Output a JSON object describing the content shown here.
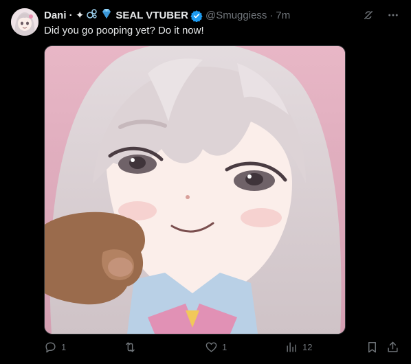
{
  "author": {
    "display_name": "Dani · ✦",
    "name_suffix": "SEAL VTUBER",
    "handle": "@Smuggiess",
    "separator": "·",
    "time": "7m",
    "avatar_icon": "anime-girl-avatar",
    "verified_color": "#1d9bf0"
  },
  "tweet": {
    "text": "Did you go pooping yet? Do it now!"
  },
  "media": {
    "kind": "image",
    "icon": "anime-girl-pointing-image"
  },
  "actions": {
    "reply_count": "1",
    "retweet_count": "",
    "like_count": "1",
    "views_count": "12"
  },
  "colors": {
    "background": "#000000",
    "text": "#e7e9ea",
    "muted": "#71767b",
    "accent": "#1d9bf0"
  }
}
